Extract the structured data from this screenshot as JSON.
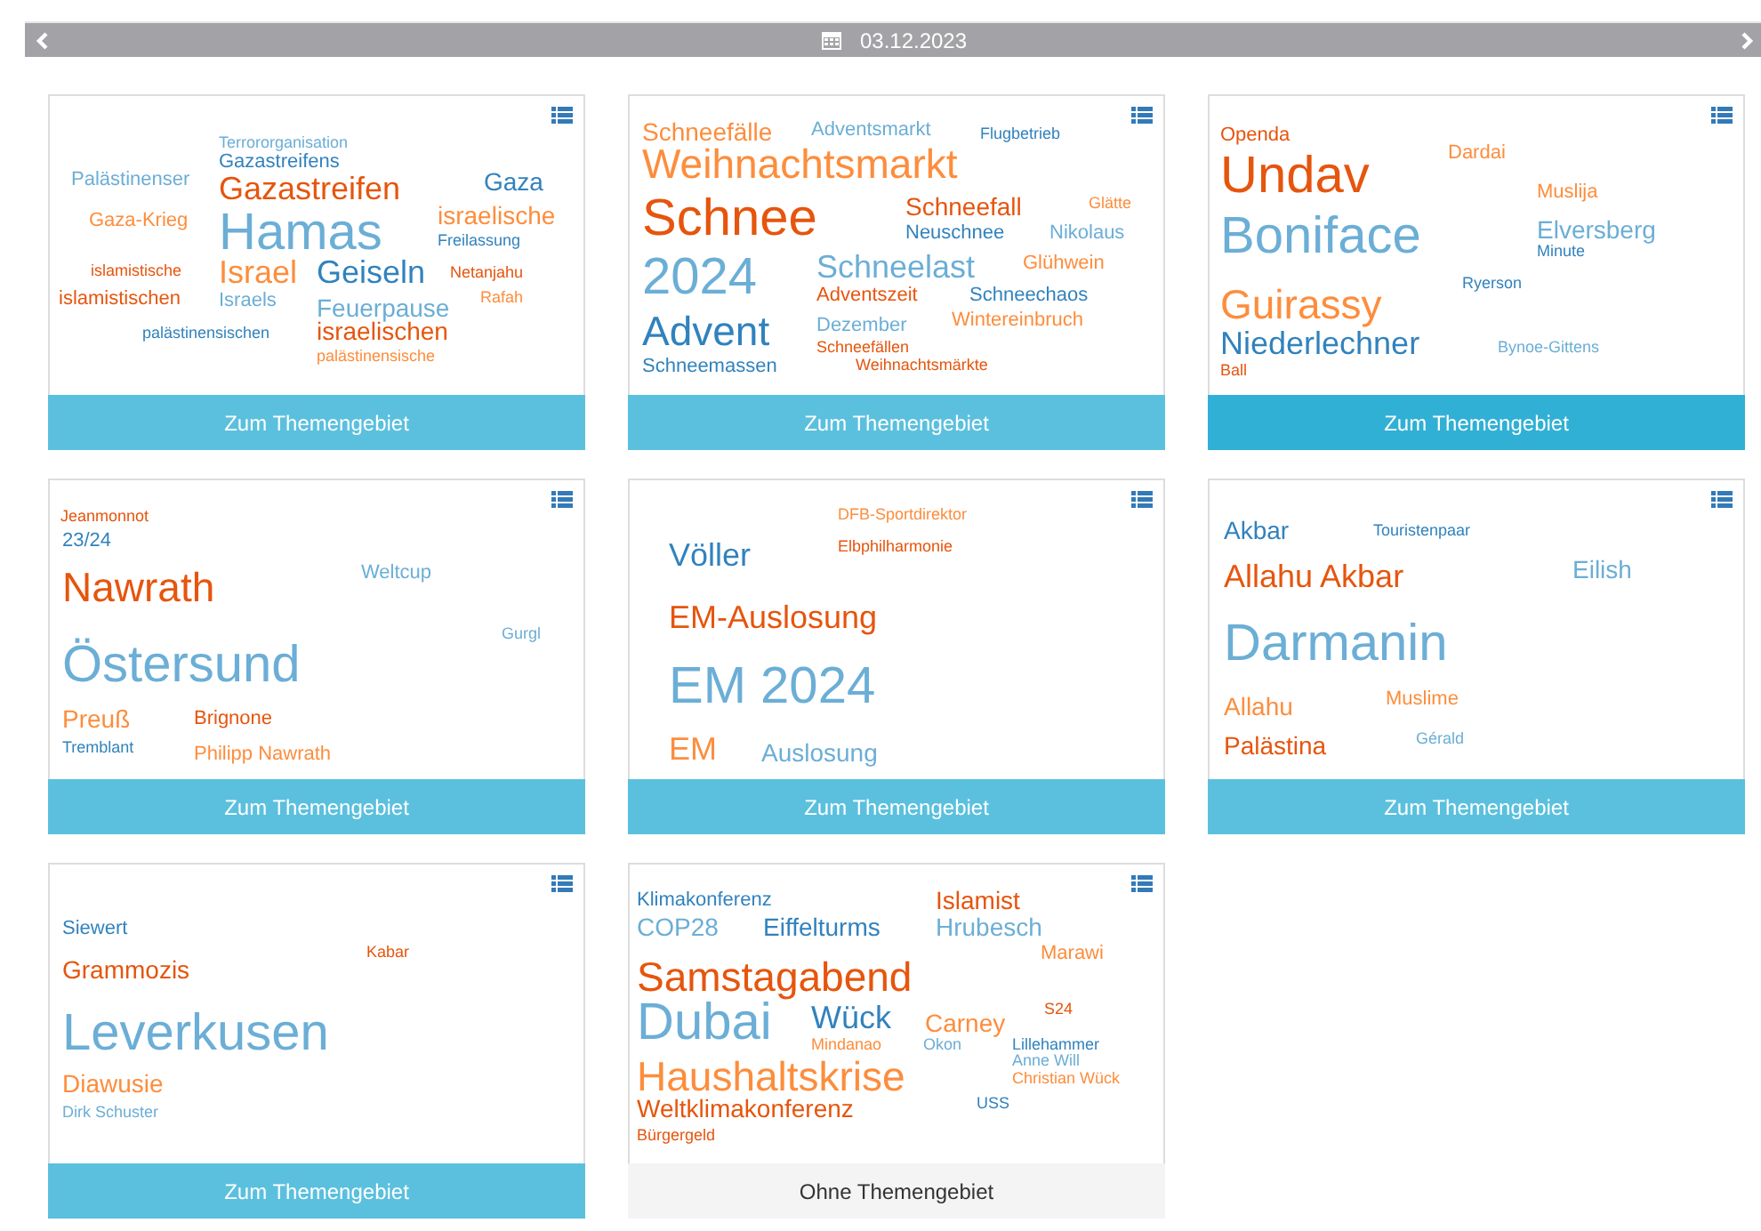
{
  "date_bar": {
    "date": "03.12.2023"
  },
  "cards": [
    {
      "footer": {
        "label": "Zum Themengebiet",
        "kind": "topic",
        "hovered": false
      },
      "words": [
        {
          "text": "Terrororganisation",
          "kind": "tiny",
          "color": "#6baed6"
        },
        {
          "text": "Gazastreifens",
          "kind": "small",
          "color": "#3182bd"
        },
        {
          "text": "Palästinenser",
          "kind": "small",
          "color": "#6baed6"
        },
        {
          "text": "Gazastreifen",
          "kind": "large",
          "color": "#e6550d"
        },
        {
          "text": "Gaza",
          "kind": "medium",
          "color": "#3182bd"
        },
        {
          "text": "Gaza-Krieg",
          "kind": "small",
          "color": "#fd8d3c"
        },
        {
          "text": "israelische",
          "kind": "medium",
          "color": "#fd8d3c"
        },
        {
          "text": "Hamas",
          "kind": "huge",
          "color": "#6baed6"
        },
        {
          "text": "Freilassung",
          "kind": "tiny",
          "color": "#3182bd"
        },
        {
          "text": "islamistische",
          "kind": "tiny",
          "color": "#e6550d"
        },
        {
          "text": "Israel",
          "kind": "large",
          "color": "#fd8d3c"
        },
        {
          "text": "Geiseln",
          "kind": "large",
          "color": "#3182bd"
        },
        {
          "text": "Netanjahu",
          "kind": "tiny",
          "color": "#e6550d"
        },
        {
          "text": "islamistischen",
          "kind": "small",
          "color": "#e6550d"
        },
        {
          "text": "Israels",
          "kind": "small",
          "color": "#6baed6"
        },
        {
          "text": "Rafah",
          "kind": "tiny",
          "color": "#fd8d3c"
        },
        {
          "text": "Feuerpause",
          "kind": "medium",
          "color": "#6baed6"
        },
        {
          "text": "palästinensischen",
          "kind": "tiny",
          "color": "#3182bd"
        },
        {
          "text": "israelischen",
          "kind": "medium",
          "color": "#e6550d"
        },
        {
          "text": "palästinensische",
          "kind": "tiny",
          "color": "#fd8d3c"
        }
      ]
    },
    {
      "footer": {
        "label": "Zum Themengebiet",
        "kind": "topic",
        "hovered": false
      },
      "words": [
        {
          "text": "Schneefälle",
          "kind": "medium",
          "color": "#fd8d3c"
        },
        {
          "text": "Adventsmarkt",
          "kind": "small",
          "color": "#6baed6"
        },
        {
          "text": "Flugbetrieb",
          "kind": "tiny",
          "color": "#3182bd"
        },
        {
          "text": "Weihnachtsmarkt",
          "kind": "big",
          "color": "#fd8d3c"
        },
        {
          "text": "Schnee",
          "kind": "huge",
          "color": "#e6550d"
        },
        {
          "text": "Schneefall",
          "kind": "medium",
          "color": "#e6550d"
        },
        {
          "text": "Glätte",
          "kind": "tiny",
          "color": "#fd8d3c"
        },
        {
          "text": "Neuschnee",
          "kind": "small",
          "color": "#3182bd"
        },
        {
          "text": "Nikolaus",
          "kind": "small",
          "color": "#6baed6"
        },
        {
          "text": "2024",
          "kind": "huge",
          "color": "#6baed6"
        },
        {
          "text": "Schneelast",
          "kind": "large",
          "color": "#6baed6"
        },
        {
          "text": "Glühwein",
          "kind": "small",
          "color": "#fd8d3c"
        },
        {
          "text": "Adventszeit",
          "kind": "small",
          "color": "#e6550d"
        },
        {
          "text": "Schneechaos",
          "kind": "small",
          "color": "#3182bd"
        },
        {
          "text": "Advent",
          "kind": "big",
          "color": "#3182bd"
        },
        {
          "text": "Dezember",
          "kind": "small",
          "color": "#6baed6"
        },
        {
          "text": "Wintereinbruch",
          "kind": "small",
          "color": "#fd8d3c"
        },
        {
          "text": "Schneefällen",
          "kind": "tiny",
          "color": "#e6550d"
        },
        {
          "text": "Schneemassen",
          "kind": "small",
          "color": "#3182bd"
        },
        {
          "text": "Weihnachtsmärkte",
          "kind": "tiny",
          "color": "#e6550d"
        }
      ]
    },
    {
      "footer": {
        "label": "Zum Themengebiet",
        "kind": "topic",
        "hovered": true
      },
      "words": [
        {
          "text": "Openda",
          "kind": "small",
          "color": "#e6550d"
        },
        {
          "text": "Dardai",
          "kind": "small",
          "color": "#fd8d3c"
        },
        {
          "text": "Undav",
          "kind": "huge",
          "color": "#e6550d"
        },
        {
          "text": "Muslija",
          "kind": "small",
          "color": "#fd8d3c"
        },
        {
          "text": "Boniface",
          "kind": "huge",
          "color": "#6baed6"
        },
        {
          "text": "Elversberg",
          "kind": "medium",
          "color": "#6baed6"
        },
        {
          "text": "Minute",
          "kind": "tiny",
          "color": "#3182bd"
        },
        {
          "text": "Ryerson",
          "kind": "tiny",
          "color": "#3182bd"
        },
        {
          "text": "Guirassy",
          "kind": "big",
          "color": "#fd8d3c"
        },
        {
          "text": "Niederlechner",
          "kind": "large",
          "color": "#3182bd"
        },
        {
          "text": "Bynoe-Gittens",
          "kind": "tiny",
          "color": "#6baed6"
        },
        {
          "text": "Ball",
          "kind": "tiny",
          "color": "#e6550d"
        }
      ]
    },
    {
      "footer": {
        "label": "Zum Themengebiet",
        "kind": "topic",
        "hovered": false
      },
      "words": [
        {
          "text": "Jeanmonnot",
          "kind": "tiny",
          "color": "#e6550d"
        },
        {
          "text": "23/24",
          "kind": "small",
          "color": "#3182bd"
        },
        {
          "text": "Nawrath",
          "kind": "big",
          "color": "#e6550d"
        },
        {
          "text": "Weltcup",
          "kind": "small",
          "color": "#6baed6"
        },
        {
          "text": "Gurgl",
          "kind": "tiny",
          "color": "#6baed6"
        },
        {
          "text": "Östersund",
          "kind": "huge",
          "color": "#6baed6"
        },
        {
          "text": "Preuß",
          "kind": "medium",
          "color": "#fd8d3c"
        },
        {
          "text": "Brignone",
          "kind": "small",
          "color": "#e6550d"
        },
        {
          "text": "Tremblant",
          "kind": "tiny",
          "color": "#3182bd"
        },
        {
          "text": "Philipp Nawrath",
          "kind": "small",
          "color": "#fd8d3c"
        }
      ]
    },
    {
      "footer": {
        "label": "Zum Themengebiet",
        "kind": "topic",
        "hovered": false
      },
      "words": [
        {
          "text": "DFB-Sportdirektor",
          "kind": "tiny",
          "color": "#fd8d3c"
        },
        {
          "text": "Völler",
          "kind": "large",
          "color": "#3182bd"
        },
        {
          "text": "Elbphilharmonie",
          "kind": "tiny",
          "color": "#e6550d"
        },
        {
          "text": "EM-Auslosung",
          "kind": "large",
          "color": "#e6550d"
        },
        {
          "text": "EM 2024",
          "kind": "huge",
          "color": "#6baed6"
        },
        {
          "text": "EM",
          "kind": "large",
          "color": "#fd8d3c"
        },
        {
          "text": "Auslosung",
          "kind": "medium",
          "color": "#6baed6"
        }
      ]
    },
    {
      "footer": {
        "label": "Zum Themengebiet",
        "kind": "topic",
        "hovered": false
      },
      "words": [
        {
          "text": "Akbar",
          "kind": "medium",
          "color": "#3182bd"
        },
        {
          "text": "Touristenpaar",
          "kind": "tiny",
          "color": "#3182bd"
        },
        {
          "text": "Allahu Akbar",
          "kind": "large",
          "color": "#e6550d"
        },
        {
          "text": "Eilish",
          "kind": "medium",
          "color": "#6baed6"
        },
        {
          "text": "Darmanin",
          "kind": "huge",
          "color": "#6baed6"
        },
        {
          "text": "Allahu",
          "kind": "medium",
          "color": "#fd8d3c"
        },
        {
          "text": "Muslime",
          "kind": "small",
          "color": "#fd8d3c"
        },
        {
          "text": "Palästina",
          "kind": "medium",
          "color": "#e6550d"
        },
        {
          "text": "Gérald",
          "kind": "tiny",
          "color": "#6baed6"
        }
      ]
    },
    {
      "footer": {
        "label": "Zum Themengebiet",
        "kind": "topic",
        "hovered": false
      },
      "words": [
        {
          "text": "Siewert",
          "kind": "small",
          "color": "#3182bd"
        },
        {
          "text": "Kabar",
          "kind": "tiny",
          "color": "#e6550d"
        },
        {
          "text": "Grammozis",
          "kind": "medium",
          "color": "#e6550d"
        },
        {
          "text": "Leverkusen",
          "kind": "huge",
          "color": "#6baed6"
        },
        {
          "text": "Diawusie",
          "kind": "medium",
          "color": "#fd8d3c"
        },
        {
          "text": "Dirk Schuster",
          "kind": "tiny",
          "color": "#6baed6"
        }
      ]
    },
    {
      "footer": {
        "label": "Ohne Themengebiet",
        "kind": "none",
        "hovered": false
      },
      "words": [
        {
          "text": "Klimakonferenz",
          "kind": "small",
          "color": "#3182bd"
        },
        {
          "text": "Islamist",
          "kind": "medium",
          "color": "#e6550d"
        },
        {
          "text": "COP28",
          "kind": "medium",
          "color": "#6baed6"
        },
        {
          "text": "Eiffelturms",
          "kind": "medium",
          "color": "#3182bd"
        },
        {
          "text": "Hrubesch",
          "kind": "medium",
          "color": "#6baed6"
        },
        {
          "text": "Marawi",
          "kind": "small",
          "color": "#fd8d3c"
        },
        {
          "text": "Samstagabend",
          "kind": "big",
          "color": "#e6550d"
        },
        {
          "text": "Dubai",
          "kind": "huge",
          "color": "#6baed6"
        },
        {
          "text": "Wück",
          "kind": "large",
          "color": "#3182bd"
        },
        {
          "text": "Carney",
          "kind": "medium",
          "color": "#fd8d3c"
        },
        {
          "text": "S24",
          "kind": "tiny",
          "color": "#e6550d"
        },
        {
          "text": "Mindanao",
          "kind": "tiny",
          "color": "#fd8d3c"
        },
        {
          "text": "Okon",
          "kind": "tiny",
          "color": "#6baed6"
        },
        {
          "text": "Lillehammer",
          "kind": "tiny",
          "color": "#3182bd"
        },
        {
          "text": "Anne Will",
          "kind": "tiny",
          "color": "#6baed6"
        },
        {
          "text": "Christian Wück",
          "kind": "tiny",
          "color": "#fd8d3c"
        },
        {
          "text": "Haushaltskrise",
          "kind": "big",
          "color": "#fd8d3c"
        },
        {
          "text": "USS",
          "kind": "tiny",
          "color": "#3182bd"
        },
        {
          "text": "Weltklimakonferenz",
          "kind": "medium",
          "color": "#e6550d"
        },
        {
          "text": "Bürgergeld",
          "kind": "tiny",
          "color": "#e6550d"
        }
      ]
    }
  ]
}
